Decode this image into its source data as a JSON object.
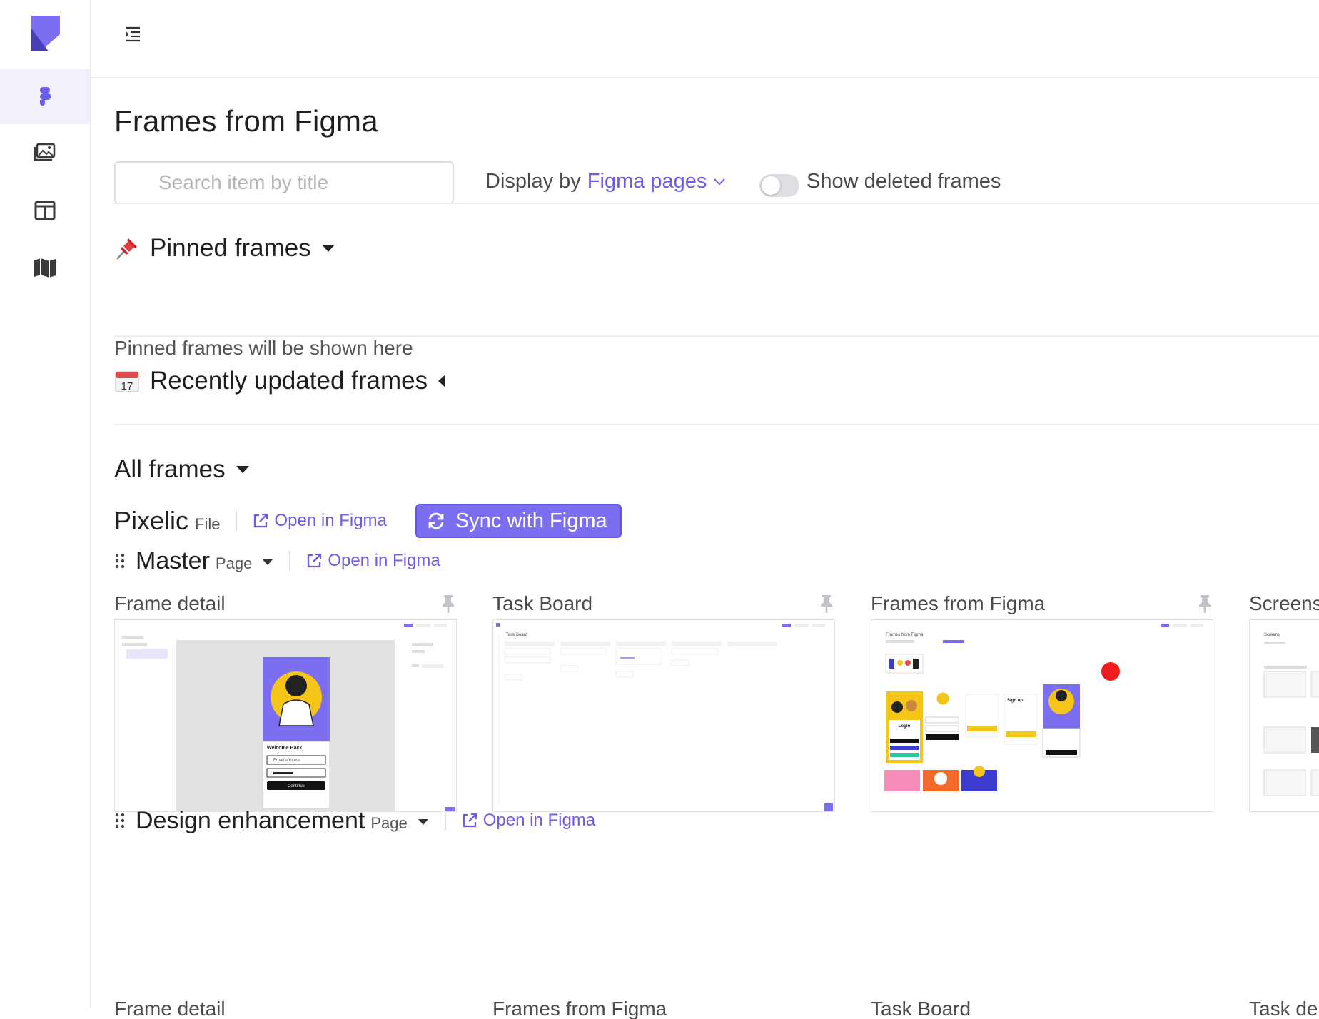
{
  "header": {
    "page_title": "Frames from Figma"
  },
  "search": {
    "placeholder": "Search item by title"
  },
  "display_by": {
    "label": "Display by",
    "value": "Figma pages"
  },
  "deleted_toggle": {
    "label": "Show deleted frames",
    "on": false
  },
  "sections": {
    "pinned": {
      "title": "Pinned frames",
      "empty_text": "Pinned frames will be shown here"
    },
    "recent": {
      "title": "Recently updated frames",
      "calendar_day": "17"
    },
    "all": {
      "title": "All frames"
    }
  },
  "file": {
    "name": "Pixelic",
    "kind": "File",
    "open_label": "Open in Figma",
    "sync_label": "Sync with Figma"
  },
  "pages": [
    {
      "name": "Master",
      "kind": "Page",
      "open_label": "Open in Figma",
      "frames": [
        "Frame detail",
        "Task Board",
        "Frames from Figma",
        "Screens"
      ]
    },
    {
      "name": "Design enhancement",
      "kind": "Page",
      "open_label": "Open in Figma",
      "frames": [
        "Frame detail",
        "Frames from Figma",
        "Task Board",
        "Task de"
      ]
    }
  ],
  "thumb_text": {
    "welcome_back": "Welcome Back",
    "email_address": "Email address",
    "continue": "Continue",
    "login": "Login",
    "sign_up": "Sign up",
    "task_board": "Task Board",
    "frames_from_figma": "Frames from Figma",
    "screens": "Screens"
  },
  "colors": {
    "accent": "#6b5de7",
    "brand": "#7b6ef0",
    "illustration_yellow": "#f5c518",
    "red_dot": "#ee1c1c"
  }
}
